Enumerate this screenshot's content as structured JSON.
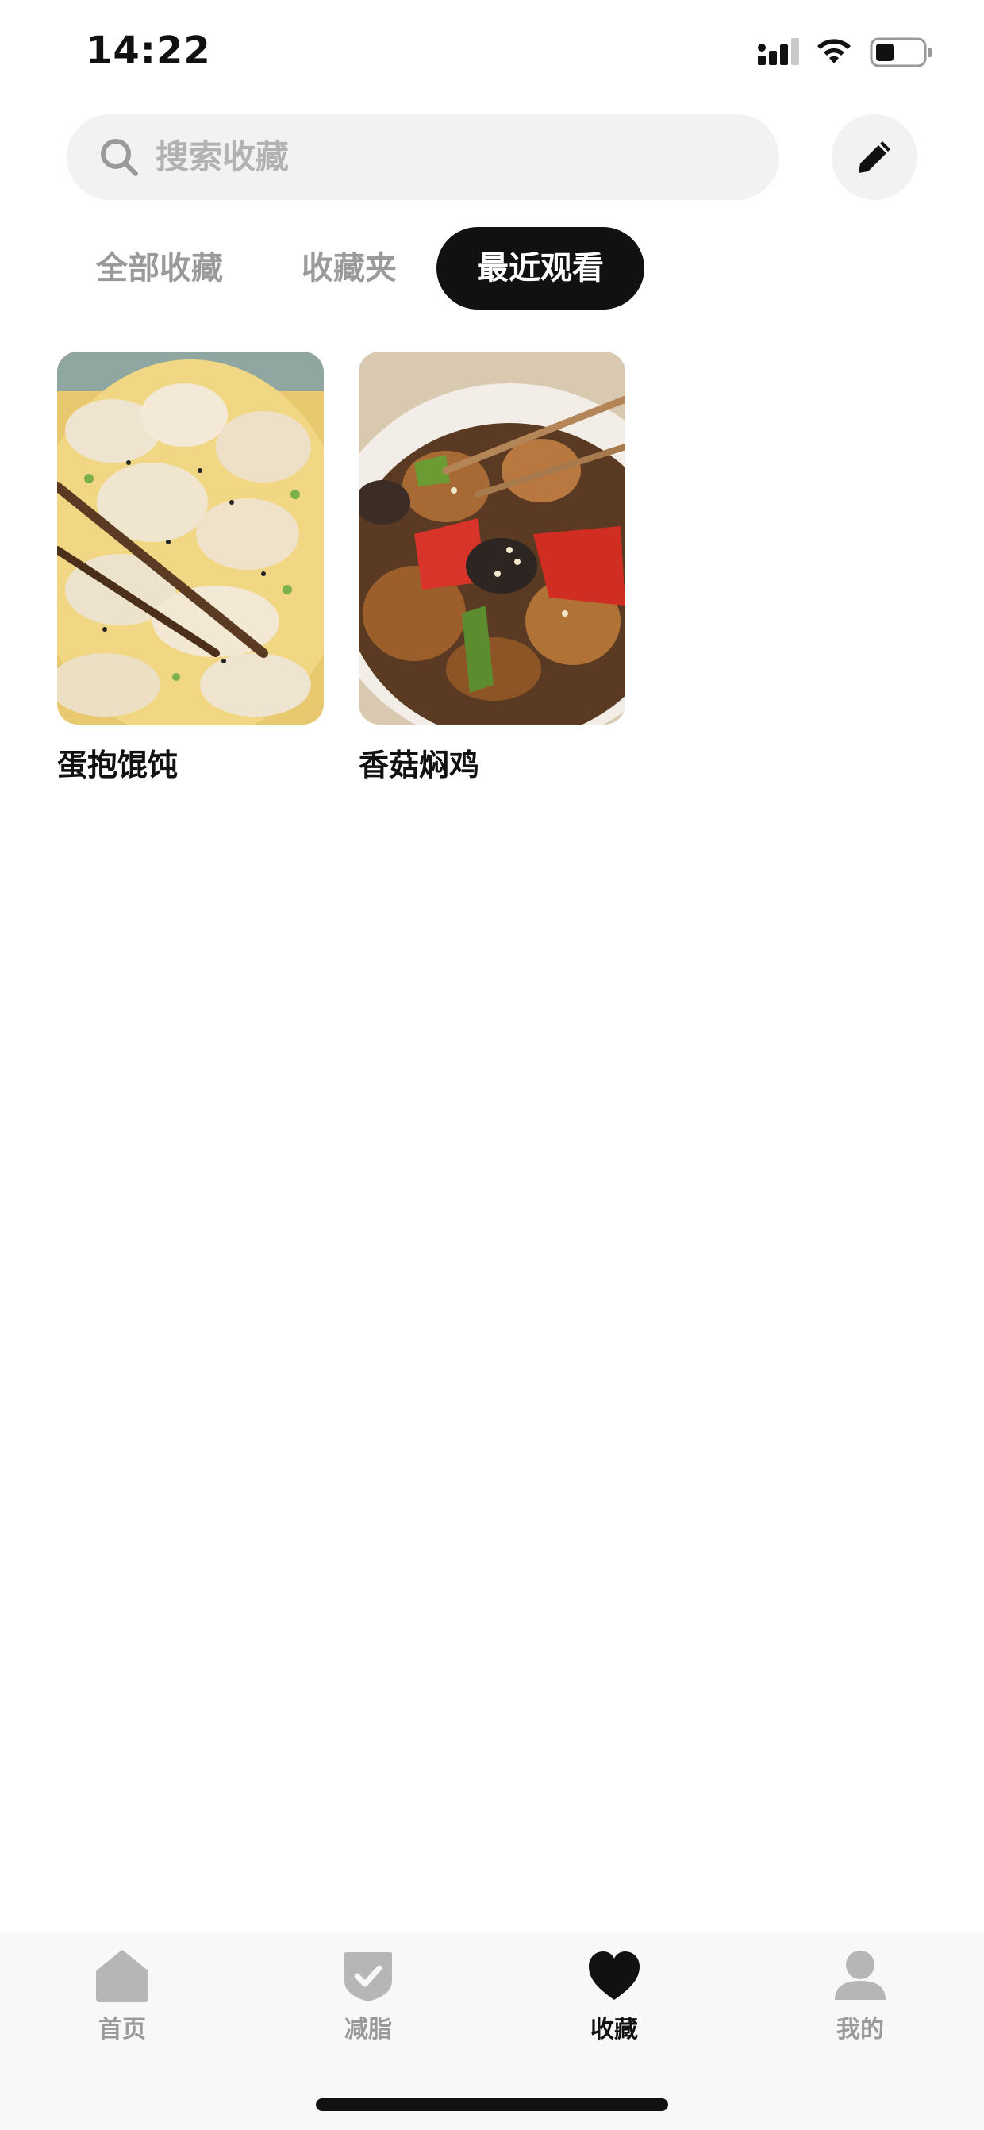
{
  "status_bar": {
    "time": "14:22"
  },
  "search": {
    "placeholder": "搜索收藏"
  },
  "tabs": [
    {
      "label": "全部收藏",
      "active": false
    },
    {
      "label": "收藏夹",
      "active": false
    },
    {
      "label": "最近观看",
      "active": true
    }
  ],
  "recent_items": [
    {
      "title": "蛋抱馄饨",
      "image": "wontons-with-egg-photo"
    },
    {
      "title": "香菇焖鸡",
      "image": "braised-chicken-mushroom-photo"
    }
  ],
  "bottom_nav": [
    {
      "label": "首页",
      "icon": "home-icon",
      "active": false
    },
    {
      "label": "减脂",
      "icon": "shield-check-icon",
      "active": false
    },
    {
      "label": "收藏",
      "icon": "heart-icon",
      "active": true
    },
    {
      "label": "我的",
      "icon": "user-icon",
      "active": false
    }
  ],
  "colors": {
    "active_tab_bg": "#111111",
    "inactive_text": "#9a9a9a",
    "search_bg": "#f2f2f2",
    "nav_bg": "#f8f8f8"
  }
}
